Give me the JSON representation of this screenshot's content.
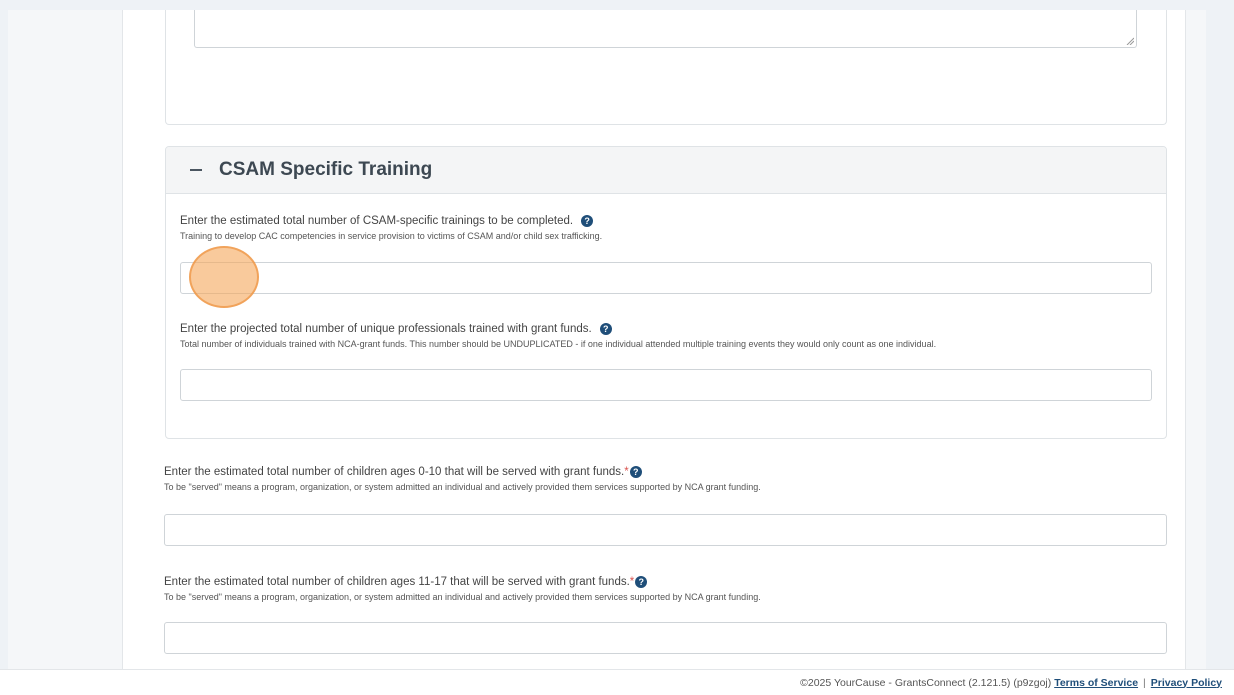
{
  "csam_section": {
    "title": "CSAM Specific Training",
    "fields": [
      {
        "label": "Enter the estimated total number of CSAM-specific trainings to be completed.",
        "help": "Training to develop CAC competencies in service provision to victims of CSAM and/or child sex trafficking.",
        "value": ""
      },
      {
        "label": "Enter the projected total number of unique professionals trained with grant funds.",
        "help": "Total number of individuals trained with NCA-grant funds. This number should be UNDUPLICATED - if one individual attended multiple training events they would only count as one individual.",
        "value": ""
      }
    ]
  },
  "children_fields": [
    {
      "label": "Enter the estimated total number of children ages 0-10 that will be served with grant funds.",
      "required_mark": "*",
      "help": "To be \"served\" means a program, organization, or system admitted an individual and actively provided them services supported by NCA grant funding.",
      "value": ""
    },
    {
      "label": "Enter the estimated total number of children ages 11-17 that will be served with grant funds.",
      "required_mark": "*",
      "help": "To be \"served\" means a program, organization, or system admitted an individual and actively provided them services supported by NCA grant funding.",
      "value": ""
    }
  ],
  "help_icon_glyph": "?",
  "footer": {
    "copyright": "©2025 YourCause - GrantsConnect (2.121.5) (p9zgoj)",
    "terms_label": "Terms of Service",
    "separator": "|",
    "privacy_label": "Privacy Policy"
  },
  "colors": {
    "accent": "#1f4e79",
    "required": "#d9534f",
    "click_marker": "#f5a65a"
  }
}
